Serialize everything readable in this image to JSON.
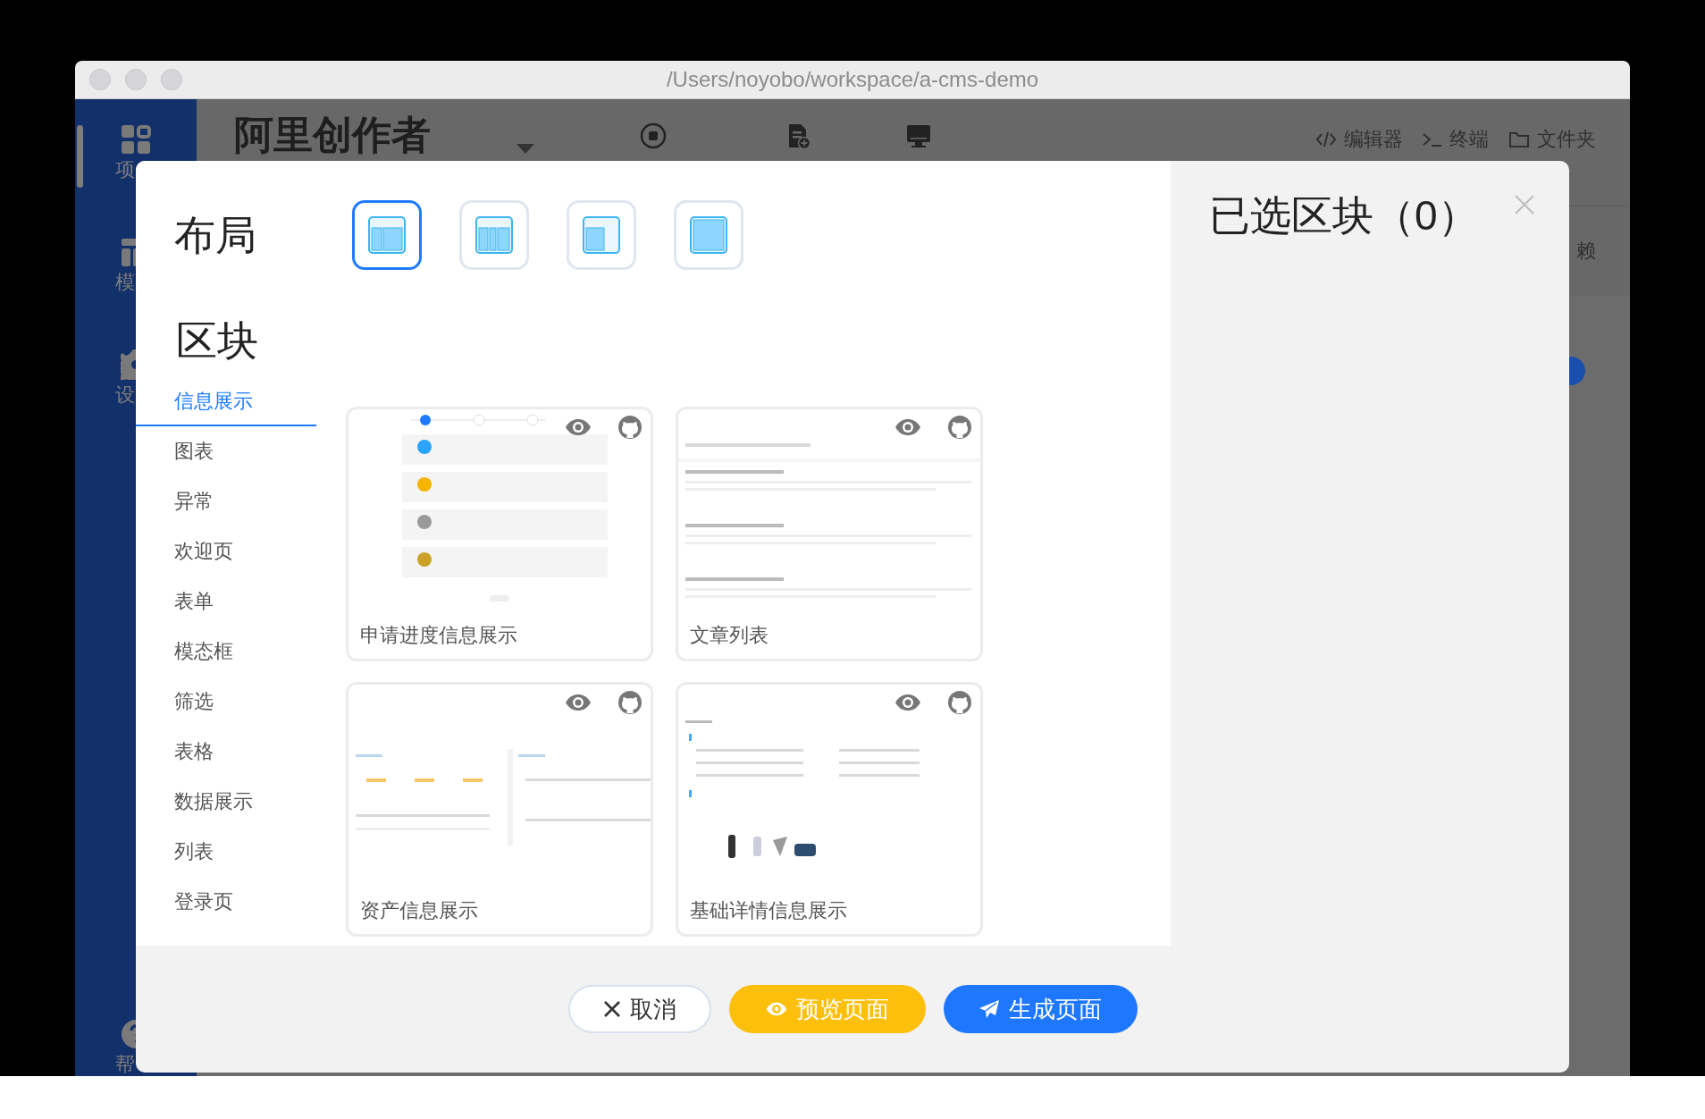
{
  "window": {
    "title": "/Users/noyobo/workspace/a-cms-demo"
  },
  "app_background": {
    "sidebar": [
      {
        "label": "项"
      },
      {
        "label": "模"
      },
      {
        "label": "设"
      },
      {
        "label": "帮"
      }
    ],
    "project_name": "阿里创作者",
    "toolbar_links": [
      {
        "kind": "editor",
        "label": "编辑器"
      },
      {
        "kind": "terminal",
        "label": "终端"
      },
      {
        "kind": "folder",
        "label": "文件夹"
      }
    ],
    "partial_text": "赖"
  },
  "dialog": {
    "layout_heading": "布局",
    "layouts": [
      {
        "kind": "two-column",
        "selected": true
      },
      {
        "kind": "three-column",
        "selected": false
      },
      {
        "kind": "wide-left",
        "selected": false
      },
      {
        "kind": "full",
        "selected": false
      }
    ],
    "blocks_heading": "区块",
    "categories": [
      {
        "label": "信息展示",
        "selected": true
      },
      {
        "label": "图表",
        "selected": false
      },
      {
        "label": "异常",
        "selected": false
      },
      {
        "label": "欢迎页",
        "selected": false
      },
      {
        "label": "表单",
        "selected": false
      },
      {
        "label": "模态框",
        "selected": false
      },
      {
        "label": "筛选",
        "selected": false
      },
      {
        "label": "表格",
        "selected": false
      },
      {
        "label": "数据展示",
        "selected": false
      },
      {
        "label": "列表",
        "selected": false
      },
      {
        "label": "登录页",
        "selected": false
      }
    ],
    "blocks": [
      {
        "title": "申请进度信息展示"
      },
      {
        "title": "文章列表"
      },
      {
        "title": "资产信息展示"
      },
      {
        "title": "基础详情信息展示"
      }
    ],
    "selected_heading": "已选区块（0）",
    "buttons": [
      {
        "kind": "cancel",
        "label": "取消"
      },
      {
        "kind": "preview",
        "label": "预览页面"
      },
      {
        "kind": "generate",
        "label": "生成页面"
      }
    ]
  }
}
